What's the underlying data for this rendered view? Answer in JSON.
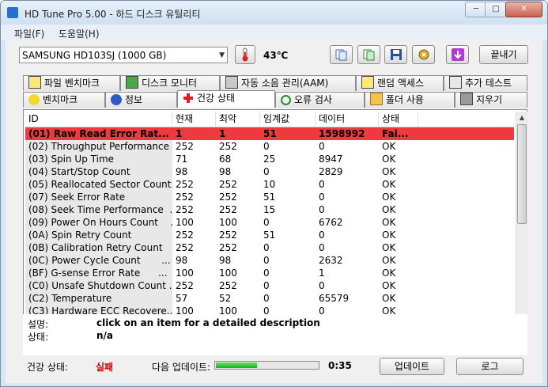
{
  "window": {
    "title": "HD Tune Pro 5.00 - 하드 디스크 유틸리티"
  },
  "menu": [
    "파일(F)",
    "도움말(H)"
  ],
  "toolbar": {
    "drive": "SAMSUNG HD103SJ (1000 GB)",
    "temperature": "43℃",
    "exit_label": "끝내기"
  },
  "tabs_top": [
    "파일 벤치마크",
    "디스크 모니터",
    "자동 소음 관리(AAM)",
    "랜덤 액세스",
    "추가 테스트"
  ],
  "tabs_bottom": [
    "벤치마크",
    "정보",
    "건강 상태",
    "오류 검사",
    "폴더 사용",
    "지우기"
  ],
  "active_tab": "건강 상태",
  "table": {
    "headers": [
      "ID",
      "현재",
      "최악",
      "임계값",
      "데이터",
      "상태"
    ],
    "rows": [
      [
        "(01) Raw Read Error Rat...",
        "1",
        "1",
        "51",
        "1598992",
        "Fai..."
      ],
      [
        "(02) Throughput Performance",
        "252",
        "252",
        "0",
        "0",
        "OK"
      ],
      [
        "(03) Spin Up Time",
        "71",
        "68",
        "25",
        "8947",
        "OK"
      ],
      [
        "(04) Start/Stop Count",
        "98",
        "98",
        "0",
        "2829",
        "OK"
      ],
      [
        "(05) Reallocated Sector Count...",
        "252",
        "252",
        "10",
        "0",
        "OK"
      ],
      [
        "(07) Seek Error Rate",
        "252",
        "252",
        "51",
        "0",
        "OK"
      ],
      [
        "(08) Seek Time Performance  ...",
        "252",
        "252",
        "15",
        "0",
        "OK"
      ],
      [
        "(09) Power On Hours Count    ...",
        "100",
        "100",
        "0",
        "6762",
        "OK"
      ],
      [
        "(0A) Spin Retry Count",
        "252",
        "252",
        "51",
        "0",
        "OK"
      ],
      [
        "(0B) Calibration Retry Count",
        "252",
        "252",
        "0",
        "0",
        "OK"
      ],
      [
        "(0C) Power Cycle Count       ...",
        "98",
        "98",
        "0",
        "2632",
        "OK"
      ],
      [
        "(BF) G-sense Error Rate      ...",
        "100",
        "100",
        "0",
        "1",
        "OK"
      ],
      [
        "(C0) Unsafe Shutdown Count ...",
        "252",
        "252",
        "0",
        "0",
        "OK"
      ],
      [
        "(C2) Temperature",
        "57",
        "52",
        "0",
        "65579",
        "OK"
      ],
      [
        "(C3) Hardware ECC Recovere...",
        "100",
        "100",
        "0",
        "0",
        "OK"
      ]
    ]
  },
  "description": {
    "desc_label": "설명:",
    "desc_value": "click on an item for a detailed description",
    "status_label": "상태:",
    "status_value": "n/a"
  },
  "footer": {
    "health_label": "건강 상태:",
    "health_value": "실패",
    "health_color": "#cc0000",
    "next_update_label": "다음 업데이트:",
    "next_update_progress": 0.4,
    "next_update_time": "0:35",
    "update_button": "업데이트",
    "log_button": "로그"
  }
}
